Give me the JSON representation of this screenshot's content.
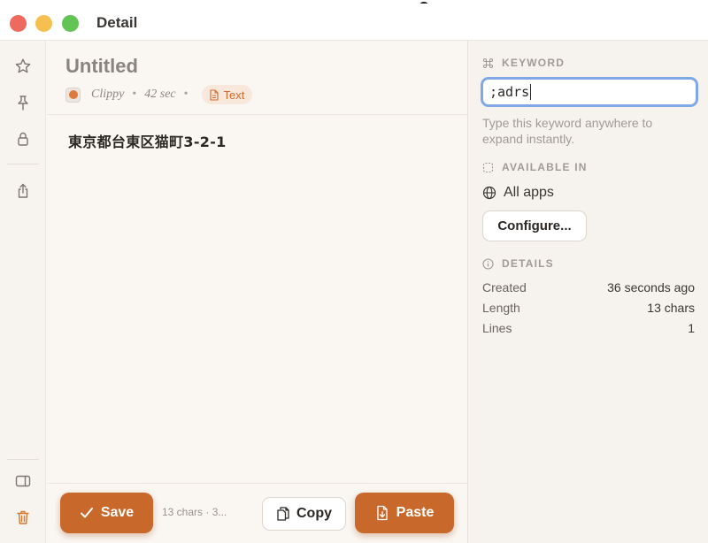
{
  "window": {
    "title": "Detail"
  },
  "rail": {
    "items": [
      {
        "name": "star-icon"
      },
      {
        "name": "pin-icon"
      },
      {
        "name": "lock-icon"
      },
      {
        "name": "share-icon"
      },
      {
        "name": "sidebar-toggle-icon"
      },
      {
        "name": "trash-icon"
      }
    ]
  },
  "document": {
    "title": "Untitled",
    "source_app": "Clippy",
    "age": "42 sec",
    "type_badge": "Text",
    "content": "東京都台東区猫町3-2-1"
  },
  "footer": {
    "save_label": "Save",
    "stats": "13 chars · 3...",
    "copy_label": "Copy",
    "paste_label": "Paste"
  },
  "panel": {
    "keyword_heading": "KEYWORD",
    "keyword_value": ";adrs",
    "keyword_hint": "Type this keyword anywhere to expand instantly.",
    "available_heading": "AVAILABLE IN",
    "available_value": "All apps",
    "configure_label": "Configure...",
    "details_heading": "DETAILS",
    "details": [
      {
        "label": "Created",
        "value": "36 seconds ago"
      },
      {
        "label": "Length",
        "value": "13 chars"
      },
      {
        "label": "Lines",
        "value": "1"
      }
    ]
  },
  "colors": {
    "accent": "#c8682b",
    "focus_ring": "#7fa8e6",
    "badge_bg": "#f8e8dc",
    "background": "#faf7f3"
  }
}
